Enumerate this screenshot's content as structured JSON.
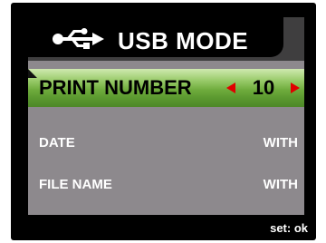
{
  "header": {
    "icon": "usb-icon",
    "title": "USB MODE"
  },
  "menu": {
    "selected": {
      "label": "PRINT NUMBER",
      "value": "10",
      "left_icon": "arrow-left-icon",
      "right_icon": "arrow-right-icon"
    },
    "items": [
      {
        "label": "DATE",
        "value": "WITH"
      },
      {
        "label": "FILE NAME",
        "value": "WITH"
      }
    ]
  },
  "footer": {
    "hint": "set: ok"
  },
  "colors": {
    "screen_bg": "#8d898d",
    "header_bg": "#000000",
    "selection_green": "#6fac3d",
    "arrow_red": "#e00000",
    "frame": "#000000"
  }
}
